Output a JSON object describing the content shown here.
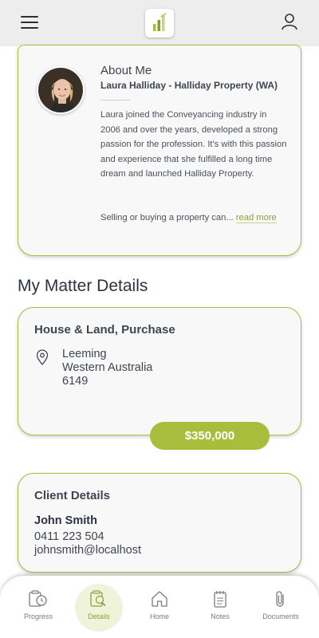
{
  "colors": {
    "accent": "#a9bd3c",
    "header_bg": "#ededed",
    "card_bg": "#f8f8f8",
    "text": "#3d4651"
  },
  "header": {
    "menu_icon": "hamburger-menu-icon",
    "logo_icon": "bar-chart-logo-icon",
    "account_icon": "user-icon"
  },
  "about": {
    "title": "About Me",
    "subtitle": "Laura Halliday - Halliday Property (WA)",
    "bio": "Laura joined the Conveyancing industry in 2006 and over the years, developed a strong passion for the profession. It's with this passion and experience that she fulfilled a long time dream and launched Halliday Property.",
    "teaser": "Selling or buying a property can...",
    "read_more": "read more"
  },
  "section_title": "My Matter Details",
  "matter": {
    "type": "House & Land, Purchase",
    "address": {
      "suburb": "Leeming",
      "state": "Western Australia",
      "postcode": "6149"
    },
    "price": "$350,000"
  },
  "client": {
    "title": "Client Details",
    "name": "John Smith",
    "phone": "0411 223 504",
    "email": "johnsmith@localhost"
  },
  "nav": {
    "items": [
      {
        "label": "Progress",
        "icon": "progress-icon"
      },
      {
        "label": "Details",
        "icon": "details-icon",
        "active": true
      },
      {
        "label": "Home",
        "icon": "home-icon"
      },
      {
        "label": "Notes",
        "icon": "notes-icon"
      },
      {
        "label": "Documents",
        "icon": "paperclip-icon"
      }
    ]
  }
}
